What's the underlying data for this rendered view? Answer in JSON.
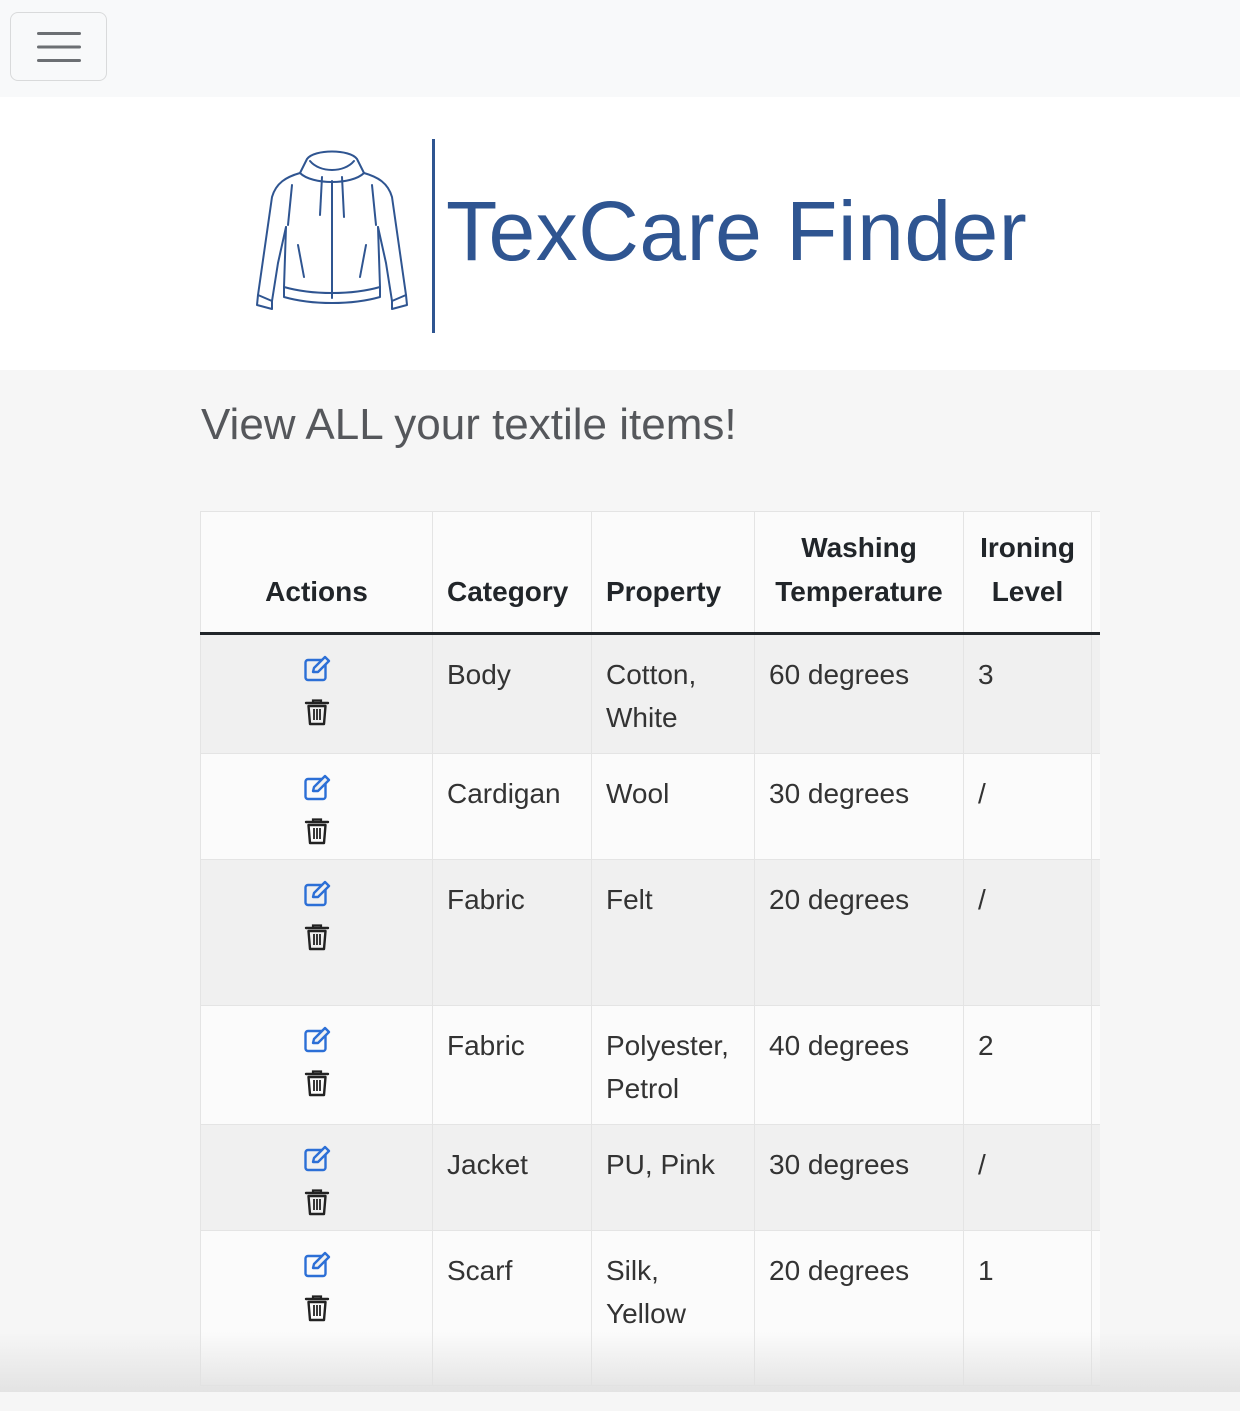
{
  "navbar": {
    "toggle_icon": "hamburger-menu-icon"
  },
  "header": {
    "logo_icon": "hoodie-jacket-icon",
    "logo_text": "TexCare Finder",
    "brand_color": "#2f5591"
  },
  "main": {
    "heading": "View ALL your textile items!",
    "table": {
      "columns": {
        "actions": "Actions",
        "category": "Category",
        "property": "Property",
        "washing_line1": "Washing",
        "washing_line2": "Temperature",
        "ironing_line1": "Ironing",
        "ironing_line2": "Level"
      },
      "action_icons": {
        "edit": "edit-pencil-icon",
        "delete": "trash-icon",
        "edit_color": "#2c6fd6"
      },
      "rows": [
        {
          "category": "Body",
          "property": "Cotton, White",
          "washing": "60 degrees",
          "ironing": "3"
        },
        {
          "category": "Cardigan",
          "property": "Wool",
          "washing": "30 degrees",
          "ironing": "/"
        },
        {
          "category": "Fabric",
          "property": "Felt",
          "washing": "20 degrees",
          "ironing": "/"
        },
        {
          "category": "Fabric",
          "property": "Polyester, Petrol",
          "washing": "40 degrees",
          "ironing": "2"
        },
        {
          "category": "Jacket",
          "property": "PU, Pink",
          "washing": "30 degrees",
          "ironing": "/"
        },
        {
          "category": "Scarf",
          "property": "Silk, Yellow",
          "washing": "20 degrees",
          "ironing": "1"
        }
      ]
    }
  }
}
